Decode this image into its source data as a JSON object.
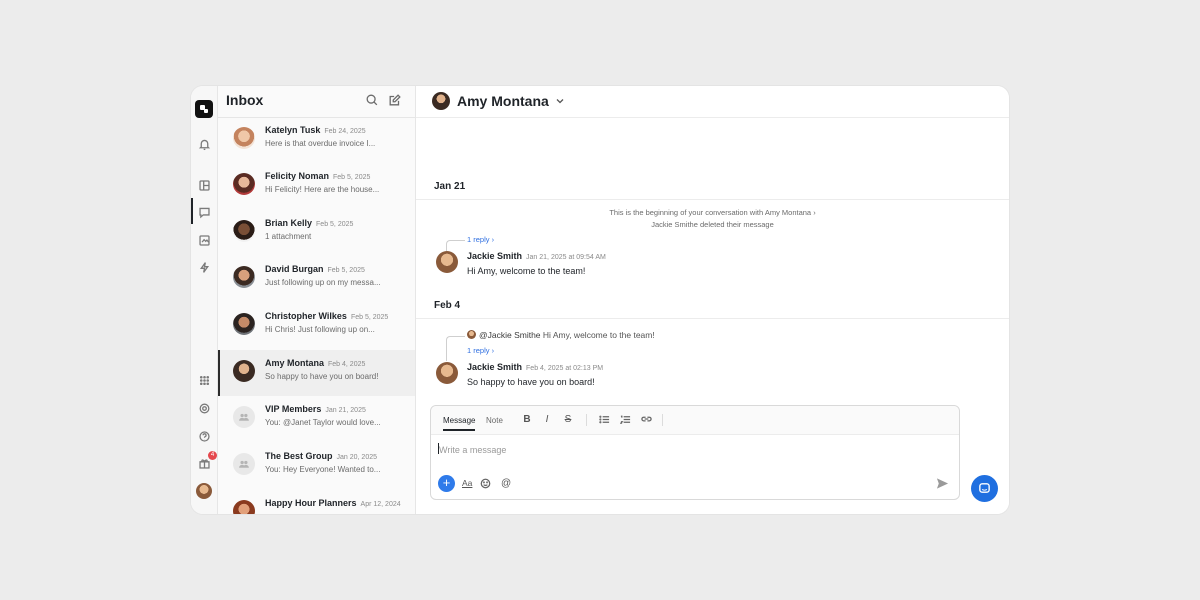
{
  "inbox": {
    "title": "Inbox",
    "conversations": [
      {
        "name": "Katelyn Tusk",
        "date": "Feb 24, 2025",
        "preview": "Here is that overdue invoice I..."
      },
      {
        "name": "Felicity Noman",
        "date": "Feb 5, 2025",
        "preview": "Hi Felicity! Here are the house..."
      },
      {
        "name": "Brian Kelly",
        "date": "Feb 5, 2025",
        "preview": "1 attachment"
      },
      {
        "name": "David Burgan",
        "date": "Feb 5, 2025",
        "preview": "Just following up on my messa..."
      },
      {
        "name": "Christopher Wilkes",
        "date": "Feb 5, 2025",
        "preview": "Hi Chris! Just following up on..."
      },
      {
        "name": "Amy Montana",
        "date": "Feb 4, 2025",
        "preview": "So happy to have you on board!"
      },
      {
        "name": "VIP Members",
        "date": "Jan 21, 2025",
        "preview": "You: @Janet Taylor would love..."
      },
      {
        "name": "The Best Group",
        "date": "Jan 20, 2025",
        "preview": "You: Hey Everyone! Wanted to..."
      },
      {
        "name": "Happy Hour Planners",
        "date": "Apr 12, 2024",
        "preview": ""
      }
    ]
  },
  "rail": {
    "gift_badge": "4"
  },
  "conversation": {
    "contact_name": "Amy Montana",
    "day1": "Jan 21",
    "system_line_1": "This is the beginning of your conversation with Amy Montana",
    "system_line_2": "Jackie Smithe deleted their message",
    "reply1": "1 reply",
    "msg1_author": "Jackie Smith",
    "msg1_time": "Jan 21, 2025 at 09:54 AM",
    "msg1_text": "Hi Amy, welcome to the team!",
    "day2": "Feb 4",
    "quote_mention": "@Jackie Smithe",
    "quote_text": "Hi Amy, welcome to the team!",
    "reply2": "1 reply",
    "msg2_author": "Jackie Smith",
    "msg2_time": "Feb 4, 2025 at 02:13 PM",
    "msg2_text": "So happy to have you on board!"
  },
  "composer": {
    "tab_message": "Message",
    "tab_note": "Note",
    "bold": "B",
    "italic": "I",
    "strike": "S",
    "placeholder": "Write a message",
    "text_format": "Aa",
    "mention": "@",
    "plus": "+"
  },
  "colors": {
    "accent": "#2f7bea",
    "fab": "#1f6fe0"
  }
}
